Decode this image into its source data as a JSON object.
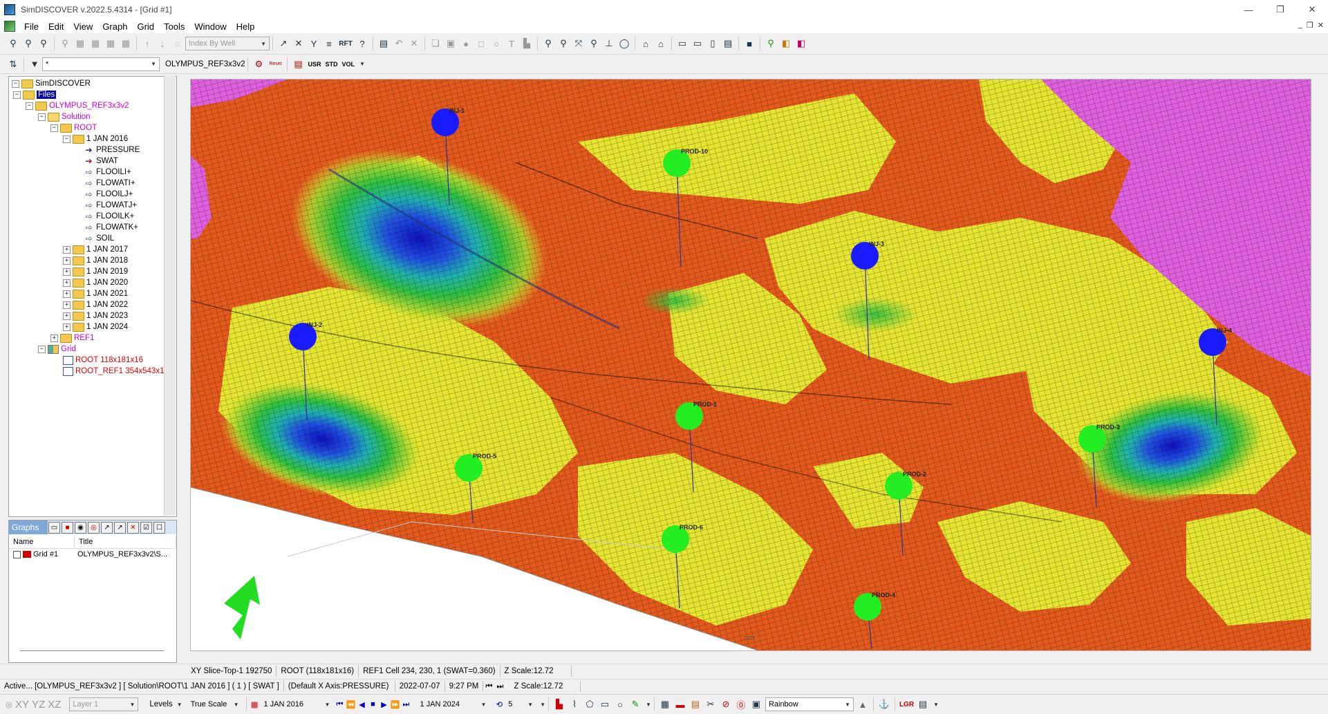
{
  "window": {
    "title": "SimDISCOVER v.2022.5.4314 - [Grid #1]",
    "controls": {
      "minimize": "—",
      "restore": "❐",
      "close": "✕"
    }
  },
  "menu": {
    "items": [
      "File",
      "Edit",
      "View",
      "Graph",
      "Grid",
      "Tools",
      "Window",
      "Help"
    ],
    "mdi_controls": [
      "_",
      "❐",
      "✕"
    ]
  },
  "toolbar1": {
    "index_by_well": "Index By Well",
    "rft_label": "RFT"
  },
  "toolbar2": {
    "filter_value": "*",
    "case_name": "OLYMPUS_REF3x3v2",
    "reset_label": "Reset",
    "usr_label": "USR",
    "std_label": "STD",
    "vol_label": "VOL"
  },
  "tree": {
    "root": "SimDISCOVER",
    "files": "Files",
    "case": "OLYMPUS_REF3x3v2",
    "solution": "Solution",
    "root_grid": "ROOT",
    "date_open": "1 JAN 2016",
    "properties": [
      "PRESSURE",
      "SWAT",
      "FLOOILI+",
      "FLOWATI+",
      "FLOOILJ+",
      "FLOWATJ+",
      "FLOOILK+",
      "FLOWATK+",
      "SOIL"
    ],
    "dates": [
      "1 JAN 2017",
      "1 JAN 2018",
      "1 JAN 2019",
      "1 JAN 2020",
      "1 JAN 2021",
      "1 JAN 2022",
      "1 JAN 2023",
      "1 JAN 2024"
    ],
    "ref1": "REF1",
    "grid": "Grid",
    "grids": [
      "ROOT 118x181x16",
      "ROOT_REF1 354x543x16"
    ]
  },
  "graphs": {
    "header": "Graphs",
    "col_name": "Name",
    "col_title": "Title",
    "row_name": "Grid #1",
    "row_title": "OLYMPUS_REF3x3v2\\S..."
  },
  "wells": [
    {
      "label": "INJ-1",
      "type": "injector"
    },
    {
      "label": "INJ-2",
      "type": "injector"
    },
    {
      "label": "INJ-3",
      "type": "injector"
    },
    {
      "label": "INJ-4",
      "type": "injector"
    },
    {
      "label": "PROD-10",
      "type": "producer"
    },
    {
      "label": "PROD-1",
      "type": "producer"
    },
    {
      "label": "PROD-2",
      "type": "producer"
    },
    {
      "label": "PROD-3",
      "type": "producer"
    },
    {
      "label": "PROD-5",
      "type": "producer"
    },
    {
      "label": "PROD-6",
      "type": "producer"
    },
    {
      "label": "PROD-4",
      "type": "producer"
    }
  ],
  "colors": {
    "injector": "#1a1aff",
    "producer": "#22ee22",
    "orange": "#e8601c",
    "yellow": "#e8e830",
    "magenta": "#e060e0",
    "green": "#40c040",
    "arrow": "#22dd22"
  },
  "status1": {
    "slice": "XY Slice-Top-1 192750",
    "root": "ROOT (118x181x16)",
    "ref1cell": "REF1 Cell 234, 230, 1 (SWAT=0.360)",
    "zscale": "Z Scale:12.72"
  },
  "status2": {
    "active": "Active... [OLYMPUS_REF3x3v2 ] [ Solution\\ROOT\\1 JAN 2016 ] ( 1 ) [ SWAT ]",
    "xaxis": "(Default X Axis:PRESSURE)",
    "date": "2022-07-07",
    "time": "9:27 PM",
    "zscale": "Z Scale:12.72"
  },
  "bottombar": {
    "xy": "XY",
    "yz": "YZ",
    "xz": "XZ",
    "layer": "Layer 1",
    "levels": "Levels",
    "true_scale": "True Scale",
    "start_date": "1 JAN 2016",
    "end_date": "1 JAN 2024",
    "step": "5",
    "palette": "Rainbow",
    "lgr": "LGR"
  }
}
